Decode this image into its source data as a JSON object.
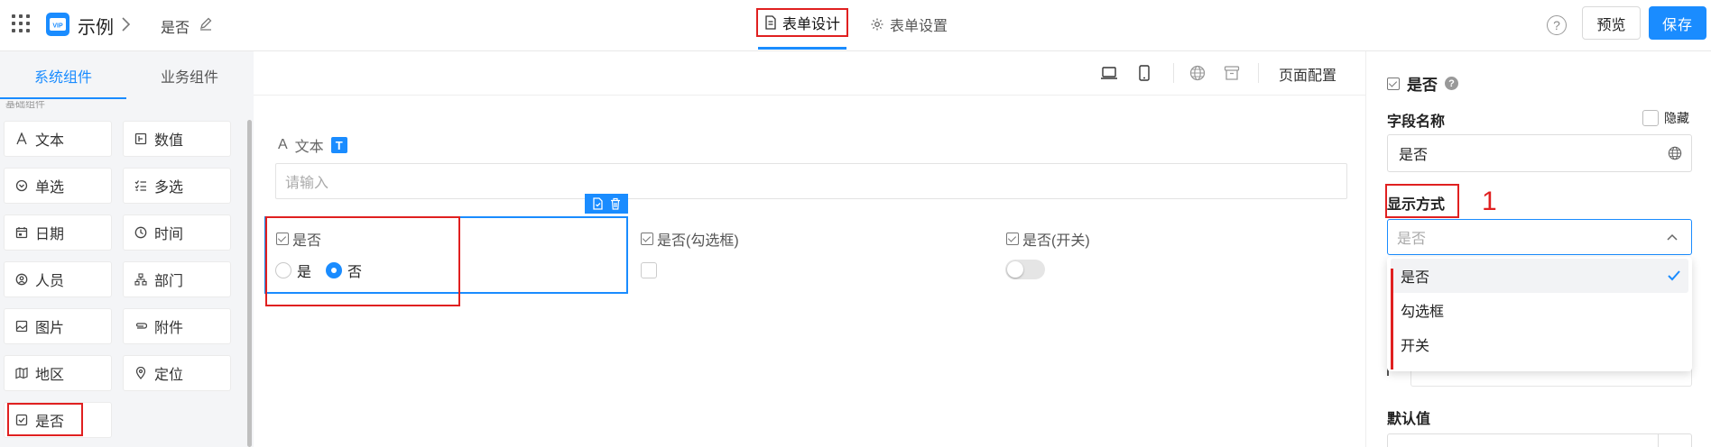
{
  "header": {
    "app_title": "示例",
    "breadcrumb_current": "是否",
    "tabs": [
      {
        "label": "表单设计",
        "active": true
      },
      {
        "label": "表单设置",
        "active": false
      }
    ],
    "preview_label": "预览",
    "save_label": "保存",
    "help_symbol": "?",
    "logo_text": "VIP"
  },
  "sidebar": {
    "tabs": [
      {
        "label": "系统组件",
        "active": true
      },
      {
        "label": "业务组件",
        "active": false
      }
    ],
    "group_label": "基础组件",
    "components": [
      {
        "label": "文本",
        "icon": "text-icon"
      },
      {
        "label": "数值",
        "icon": "number-icon"
      },
      {
        "label": "单选",
        "icon": "radio-icon"
      },
      {
        "label": "多选",
        "icon": "checklist-icon"
      },
      {
        "label": "日期",
        "icon": "calendar-icon"
      },
      {
        "label": "时间",
        "icon": "clock-icon"
      },
      {
        "label": "人员",
        "icon": "person-icon"
      },
      {
        "label": "部门",
        "icon": "org-icon"
      },
      {
        "label": "图片",
        "icon": "image-icon"
      },
      {
        "label": "附件",
        "icon": "paperclip-icon"
      },
      {
        "label": "地区",
        "icon": "map-icon"
      },
      {
        "label": "定位",
        "icon": "location-icon"
      },
      {
        "label": "是否",
        "icon": "checkbox-icon",
        "highlighted": true
      }
    ]
  },
  "canvas": {
    "toolbar": {
      "page_config_label": "页面配置"
    },
    "text_field": {
      "label": "文本",
      "badge": "T",
      "prefix": "A",
      "placeholder": "请输入"
    },
    "yesno_fields": [
      {
        "label": "是否",
        "options": [
          {
            "label": "是",
            "selected": false
          },
          {
            "label": "否",
            "selected": true
          }
        ]
      },
      {
        "label": "是否(勾选框)"
      },
      {
        "label": "是否(开关)"
      }
    ]
  },
  "properties": {
    "title": "是否",
    "help_symbol": "?",
    "field_name_label": "字段名称",
    "hide_label": "隐藏",
    "field_name_value": "是否",
    "display_mode_label": "显示方式",
    "annotation_number": "1",
    "display_mode_placeholder": "是否",
    "display_options": [
      {
        "label": "是否",
        "selected": true
      },
      {
        "label": "勾选框",
        "selected": false
      },
      {
        "label": "开关",
        "selected": false
      }
    ],
    "default_value_label": "默认值"
  },
  "colors": {
    "accent": "#1a8cff",
    "annotation_red": "#e02020"
  }
}
